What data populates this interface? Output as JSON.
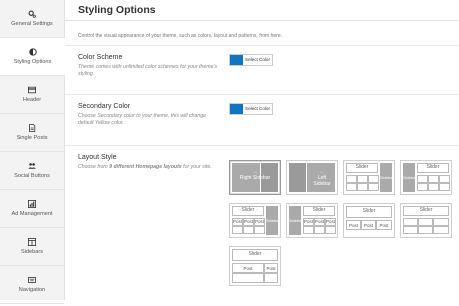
{
  "sidebar": {
    "items": [
      {
        "label": "General Settings",
        "icon": "gears-icon"
      },
      {
        "label": "Styling Options",
        "icon": "contrast-icon"
      },
      {
        "label": "Header",
        "icon": "card-icon"
      },
      {
        "label": "Single Posts",
        "icon": "document-icon"
      },
      {
        "label": "Social Buttons",
        "icon": "users-icon"
      },
      {
        "label": "Ad Management",
        "icon": "chart-icon"
      },
      {
        "label": "Sidebars",
        "icon": "columns-icon"
      },
      {
        "label": "Navigation",
        "icon": "keyboard-icon"
      }
    ]
  },
  "page": {
    "title": "Styling Options",
    "intro": "Control the visual appearance of your theme, such as colors, layout and patterns, from here."
  },
  "color_scheme": {
    "title": "Color Scheme",
    "desc": "Theme comes with unlimited color schemes for your theme's styling.",
    "button": "Select Color",
    "color": "#0f76c5"
  },
  "secondary_color": {
    "title": "Secondary Color",
    "desc": "Choose Secondary color to your theme, this will change default Yellow color.",
    "button": "Select Color",
    "color": "#0f76c5"
  },
  "layout_style": {
    "title": "Layout Style",
    "desc_pre": "Choose from ",
    "desc_bold": "9 different Homepage layouts",
    "desc_post": " for your site.",
    "labels": {
      "right_sidebar": "Right Sidebar",
      "left_sidebar": "Left Sidebar",
      "slider": "Slider",
      "sidebar": "Sidebar",
      "post": "Post",
      "arrow_right": "→",
      "arrow_left": "←"
    }
  }
}
